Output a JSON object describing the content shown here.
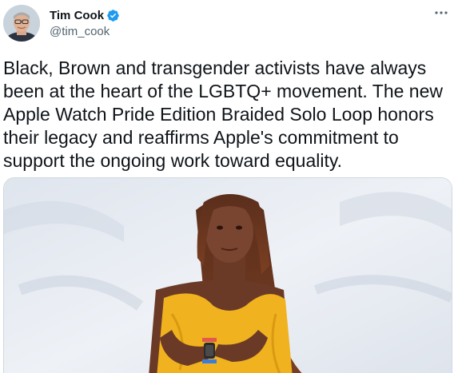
{
  "author": {
    "display_name": "Tim Cook",
    "handle": "@tim_cook",
    "verified": true
  },
  "icons": {
    "avatar": "avatar-photo",
    "verified": "verified-badge-icon",
    "more": "more-options-icon"
  },
  "colors": {
    "verified_blue": "#1d9bf0",
    "text": "#0f1419",
    "secondary_text": "#536471"
  },
  "tweet": {
    "lines": [
      "Black, Brown and transgender activists have always",
      "been at the heart of the LGBTQ+ movement. The new",
      "Apple Watch Pride Edition Braided Solo Loop honors",
      "their legacy and reaffirms Apple's commitment to",
      "support the ongoing work toward equality."
    ]
  }
}
